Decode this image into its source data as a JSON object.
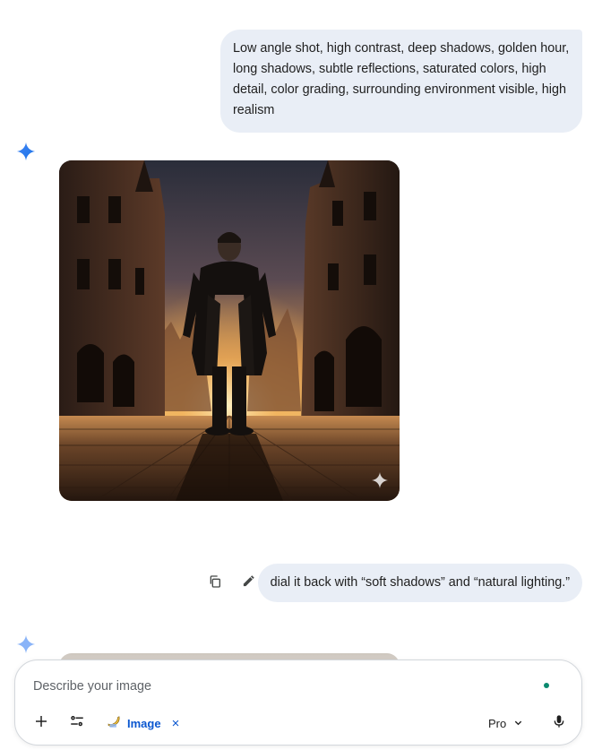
{
  "conversation": {
    "prompt_1": "Low angle shot, high contrast, deep shadows, golden hour, long shadows, subtle reflections, saturated colors, high detail, color grading, surrounding environment visible, high realism",
    "prompt_2": "dial it back with “soft shadows” and “natural lighting.”",
    "generated_image_subject": "Man in a dark long coat standing on a cobblestone street between gothic buildings at sunset",
    "message_actions": [
      "copy-icon",
      "edit-pencil-icon"
    ],
    "response_icon": "gemini-sparkle-icon"
  },
  "composer": {
    "placeholder": "Describe your image",
    "tool_chip_label": "Image",
    "tool_chip_close": "×",
    "model_label": "Pro",
    "icons": [
      "plus-icon",
      "tools-sliders-icon",
      "banana-icon",
      "chevron-down-icon",
      "microphone-icon"
    ]
  },
  "colors": {
    "accent_blue": "#0b57d0",
    "bubble_bg": "#e9eef6",
    "status_dot": "#0b8a6f",
    "sparkle_blue": "#4285f4"
  }
}
